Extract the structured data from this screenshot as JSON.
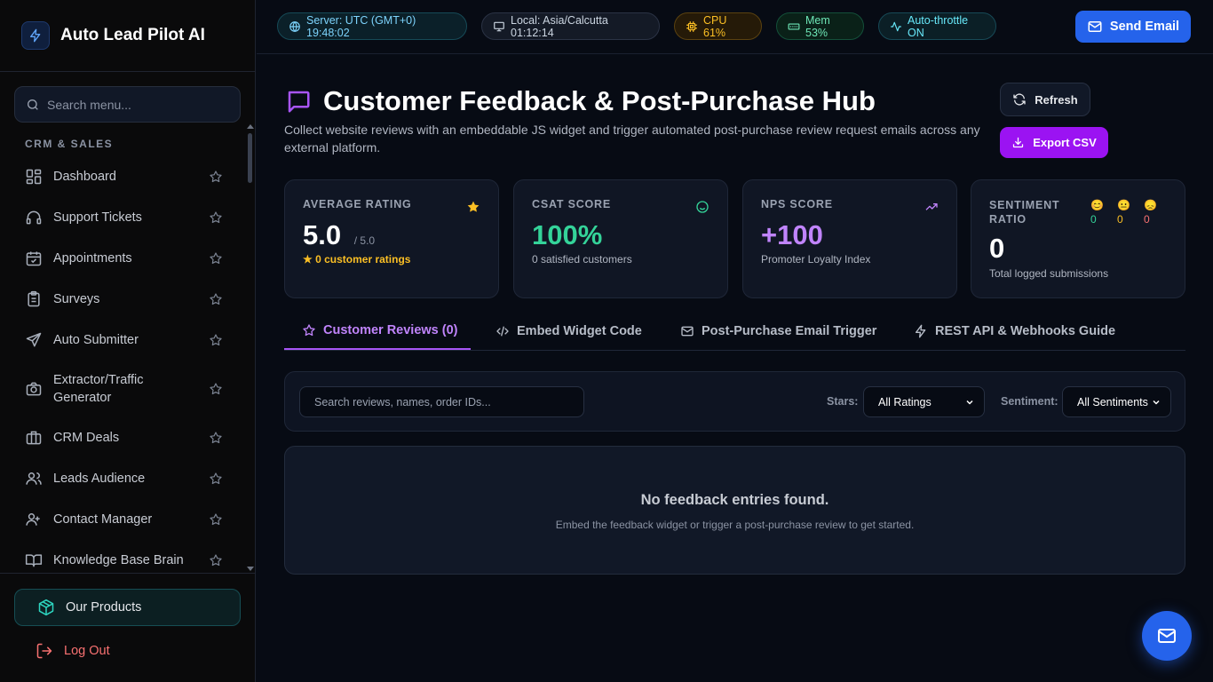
{
  "brand": {
    "title": "Auto Lead Pilot AI"
  },
  "sidebar": {
    "search_placeholder": "Search menu...",
    "section_label": "CRM & SALES",
    "items": [
      {
        "label": "Dashboard",
        "icon": "dashboard-icon"
      },
      {
        "label": "Support Tickets",
        "icon": "headset-icon"
      },
      {
        "label": "Appointments",
        "icon": "calendar-icon"
      },
      {
        "label": "Surveys",
        "icon": "clipboard-icon"
      },
      {
        "label": "Auto Submitter",
        "icon": "send-icon"
      },
      {
        "label": "Extractor/Traffic Generator",
        "icon": "camera-icon"
      },
      {
        "label": "CRM Deals",
        "icon": "briefcase-icon"
      },
      {
        "label": "Leads Audience",
        "icon": "users-icon"
      },
      {
        "label": "Contact Manager",
        "icon": "contacts-icon"
      },
      {
        "label": "Knowledge Base Brain",
        "icon": "book-icon"
      }
    ],
    "products_label": "Our Products",
    "logout_label": "Log Out"
  },
  "topbar": {
    "server_time": "Server: UTC (GMT+0) 19:48:02",
    "local_time": "Local: Asia/Calcutta 01:12:14",
    "cpu": "CPU 61%",
    "mem": "Mem 53%",
    "throttle": "Auto-throttle ON",
    "send_email_label": "Send Email"
  },
  "header": {
    "title": "Customer Feedback & Post-Purchase Hub",
    "description": "Collect website reviews with an embeddable JS widget and trigger automated post-purchase review request emails across any external platform.",
    "refresh_label": "Refresh",
    "export_label": "Export CSV"
  },
  "stats": {
    "avg_rating": {
      "label": "AVERAGE RATING",
      "value": "5.0",
      "suffix": "/ 5.0",
      "sub": "★ 0 customer ratings"
    },
    "csat": {
      "label": "CSAT SCORE",
      "value": "100%",
      "sub": "0 satisfied customers"
    },
    "nps": {
      "label": "NPS SCORE",
      "value": "+100",
      "sub": "Promoter Loyalty Index"
    },
    "sentiment": {
      "label_line1": "SENTIMENT",
      "label_line2": "RATIO",
      "positive": "0",
      "neutral": "0",
      "negative": "0",
      "positive_emoji": "😊",
      "neutral_emoji": "😐",
      "negative_emoji": "😞",
      "value": "0",
      "sub": "Total logged submissions"
    }
  },
  "tabs": [
    {
      "label": "Customer Reviews (0)"
    },
    {
      "label": "Embed Widget Code"
    },
    {
      "label": "Post-Purchase Email Trigger"
    },
    {
      "label": "REST API & Webhooks Guide"
    }
  ],
  "filters": {
    "search_placeholder": "Search reviews, names, order IDs...",
    "stars_label": "Stars:",
    "stars_value": "All Ratings",
    "sentiment_label": "Sentiment:",
    "sentiment_value": "All Sentiments"
  },
  "empty_state": {
    "title": "No feedback entries found.",
    "subtitle": "Embed the feedback widget or trigger a post-purchase review to get started."
  },
  "colors": {
    "accent_purple": "#a855f7",
    "primary_blue": "#2563eb",
    "csat_green": "#34d399",
    "nps_purple": "#c084fc",
    "rating_star": "#fbbf24"
  }
}
